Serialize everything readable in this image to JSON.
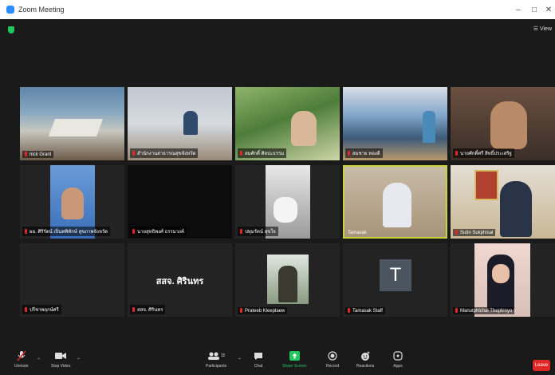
{
  "window": {
    "title": "Zoom Meeting",
    "min_glyph": "–",
    "max_glyph": "□",
    "close_glyph": "✕"
  },
  "view_label": "View",
  "tiles": [
    {
      "name": "nick Grant"
    },
    {
      "name": "สำนักงานสาธารณสุขจังหวัด"
    },
    {
      "name": "สมศักดิ์ ศิลปะธรรม"
    },
    {
      "name": "สมชาย ทองดี"
    },
    {
      "name": "นายศักดิ์ศรี สิทธิ์ประเสริฐ"
    },
    {
      "name": "ผอ. ศิริรัตน์ เปิ่นทพิทักษ์ สุขภาพจังหวัด"
    },
    {
      "name": "นายสุทธิพงศ์ ธรรมวงค์"
    },
    {
      "name": "ปทุมรัตน์ สุขใจ"
    },
    {
      "name": "Tamasak"
    },
    {
      "name": "Sutin Sukphisal"
    },
    {
      "name": "ปรีชาพฤกษ์ศรี"
    },
    {
      "name": "สสจ. ศิรินทร",
      "caption": "สสจ. ศิรินทร"
    },
    {
      "name": "Prateeb Kleeplaew"
    },
    {
      "name": "Tamasak Staff",
      "initial": "T"
    },
    {
      "name": "Manutphichai Thephinyo"
    }
  ],
  "controls": {
    "unmute": "Unmute",
    "stop_video": "Stop Video",
    "participants": "Participants",
    "participants_count": "15",
    "chat": "Chat",
    "share_screen": "Share Screen",
    "record": "Record",
    "reactions": "Reactions",
    "apps": "Apps",
    "leave": "Leave"
  },
  "colors": {
    "share_green": "#22c55e",
    "leave_red": "#e02828",
    "active_border": "#c9d43a",
    "mic_red": "#e02828",
    "zoom_blue": "#2d8cff"
  }
}
